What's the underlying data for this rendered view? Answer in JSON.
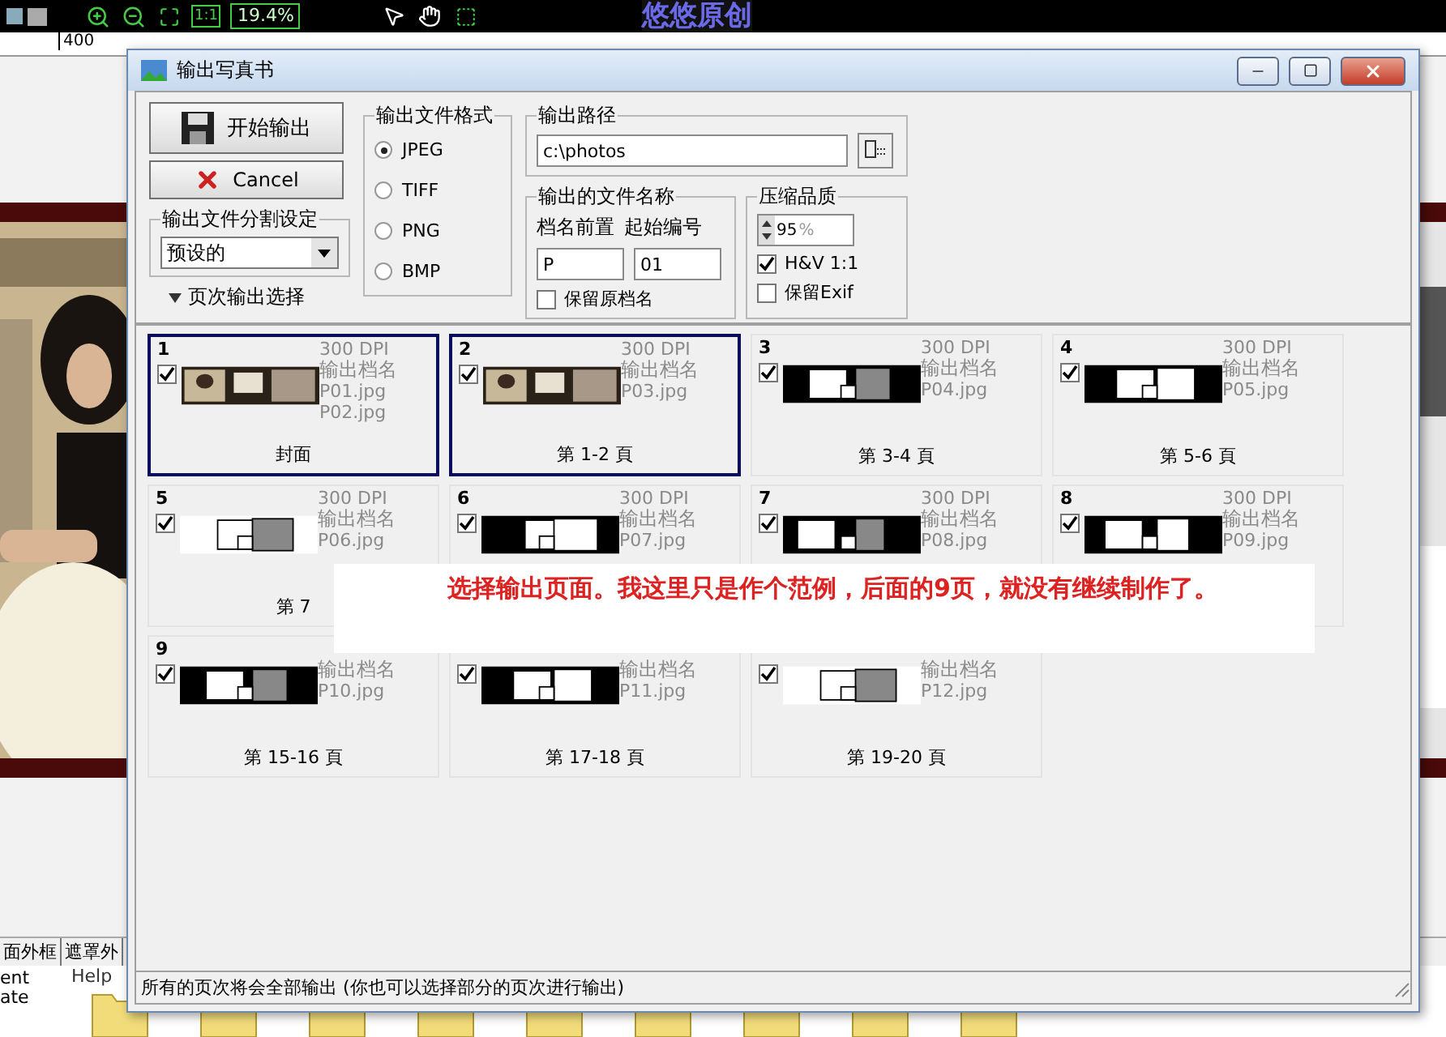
{
  "app": {
    "title": "悠悠原创",
    "zoom": "19.4%",
    "actual_size": "1:1",
    "ruler_label": "400",
    "tabs": [
      "面外框",
      "遮罩外"
    ],
    "folders": [
      {
        "label_lines": [
          "ent",
          "ate"
        ],
        "kind": "text"
      },
      {
        "label_lines": [
          "Help"
        ],
        "kind": "folder"
      },
      {
        "kind": "folder"
      },
      {
        "kind": "folder"
      },
      {
        "kind": "folder"
      },
      {
        "kind": "folder"
      },
      {
        "kind": "folder"
      },
      {
        "kind": "folder"
      },
      {
        "kind": "folder"
      },
      {
        "kind": "folder"
      }
    ]
  },
  "dialog": {
    "title": "输出写真书",
    "start_button": "开始输出",
    "cancel_button": "Cancel",
    "split": {
      "legend": "输出文件分割设定",
      "value": "预设的"
    },
    "page_toggle": "页次输出选择",
    "format": {
      "legend": "输出文件格式",
      "options": [
        {
          "label": "JPEG",
          "selected": true
        },
        {
          "label": "TIFF",
          "selected": false
        },
        {
          "label": "PNG",
          "selected": false
        },
        {
          "label": "BMP",
          "selected": false
        }
      ]
    },
    "path": {
      "legend": "输出路径",
      "value": "c:\\photos"
    },
    "filename": {
      "legend": "输出的文件名称",
      "prefix_label": "档名前置",
      "start_label": "起始编号",
      "prefix": "P",
      "start": "01",
      "keep_original": {
        "label": "保留原档名",
        "checked": false
      }
    },
    "quality": {
      "legend": "压缩品质",
      "value": "95",
      "unit": "%",
      "options": [
        {
          "label": "H&V 1:1",
          "checked": true
        },
        {
          "label": "保留Exif",
          "checked": false
        }
      ]
    },
    "pages": [
      {
        "number": "1",
        "selected": true,
        "checked": true,
        "dpi": "300 DPI",
        "name_label": "输出档名",
        "files": [
          "P01.jpg",
          "P02.jpg"
        ],
        "caption": "封面"
      },
      {
        "number": "2",
        "selected": true,
        "checked": true,
        "dpi": "300 DPI",
        "name_label": "输出档名",
        "files": [
          "P03.jpg"
        ],
        "caption": "第 1-2 頁"
      },
      {
        "number": "3",
        "selected": false,
        "checked": true,
        "dpi": "300 DPI",
        "name_label": "输出档名",
        "files": [
          "P04.jpg"
        ],
        "caption": "第 3-4 頁"
      },
      {
        "number": "4",
        "selected": false,
        "checked": true,
        "dpi": "300 DPI",
        "name_label": "输出档名",
        "files": [
          "P05.jpg"
        ],
        "caption": "第 5-6 頁"
      },
      {
        "number": "5",
        "selected": false,
        "checked": true,
        "dpi": "300 DPI",
        "name_label": "输出档名",
        "files": [
          "P06.jpg"
        ],
        "caption": "第 7"
      },
      {
        "number": "6",
        "selected": false,
        "checked": true,
        "dpi": "300 DPI",
        "name_label": "输出档名",
        "files": [
          "P07.jpg"
        ]
      },
      {
        "number": "7",
        "selected": false,
        "checked": true,
        "dpi": "300 DPI",
        "name_label": "输出档名",
        "files": [
          "P08.jpg"
        ]
      },
      {
        "number": "8",
        "selected": false,
        "checked": true,
        "dpi": "300 DPI",
        "name_label": "输出档名",
        "files": [
          "P09.jpg"
        ]
      },
      {
        "number": "9",
        "selected": false,
        "checked": true,
        "name_label": "输出档名",
        "files": [
          "P10.jpg"
        ],
        "caption": "第 15-16 頁"
      },
      {
        "selected": false,
        "checked": true,
        "name_label": "输出档名",
        "files": [
          "P11.jpg"
        ],
        "caption": "第 17-18 頁"
      },
      {
        "selected": false,
        "checked": true,
        "name_label": "输出档名",
        "files": [
          "P12.jpg"
        ],
        "caption": "第 19-20 頁"
      }
    ],
    "annotation": "选择输出页面。我这里只是作个范例，后面的9页，就没有继续制作了。",
    "status": "所有的页次将会全部输出 (你也可以选择部分的页次进行输出)"
  }
}
